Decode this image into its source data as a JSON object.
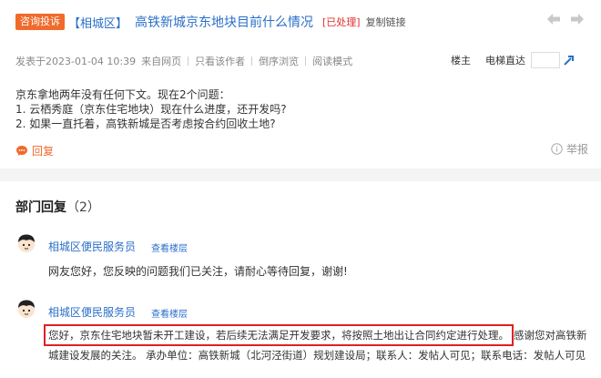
{
  "post": {
    "tag": "咨询投诉",
    "district": "【相城区】",
    "title": "高铁新城京东地块目前什么情况",
    "status": "[已处理]",
    "copy_link": "复制链接"
  },
  "nav": {
    "prev_icon": "arrow-left-icon",
    "next_icon": "arrow-right-icon"
  },
  "meta": {
    "posted": "发表于2023-01-04 10:39",
    "source": "来自网页",
    "only_author": "只看该作者",
    "reverse": "倒序浏览",
    "read_mode": "阅读模式"
  },
  "floor": {
    "owner": "楼主",
    "jump_label": "电梯直达",
    "jump_value": ""
  },
  "content": {
    "lines": [
      "京东拿地两年没有任何下文。现在2个问题：",
      "1. 云栖秀庭（京东住宅地块）现在什么进度，还开发吗?",
      "2. 如果一直托着，高铁新城是否考虑按合约回收土地?"
    ]
  },
  "actions": {
    "reply": "回复",
    "report": "举报"
  },
  "dept": {
    "title": "部门回复",
    "count": "（2）",
    "replies": [
      {
        "name": "相城区便民服务员",
        "view_floor": "查看楼层",
        "text": "网友您好，您反映的问题我们已关注，请耐心等待回复，谢谢!"
      },
      {
        "name": "相城区便民服务员",
        "view_floor": "查看楼层",
        "highlight": "您好，京东住宅地块暂未开工建设，若后续无法满足开发要求，将按照土地出让合同约定进行处理。",
        "after": "感谢您对高铁新",
        "line2": "城建设发展的关注。 承办单位：高铁新城（北河泾街道）规划建设局；联系人：发帖人可见；联系电话：发帖人可见"
      }
    ]
  },
  "colors": {
    "accent": "#f06a2b",
    "link": "#2a6fc9",
    "status": "#e0302e",
    "highlight_border": "#e02020"
  }
}
